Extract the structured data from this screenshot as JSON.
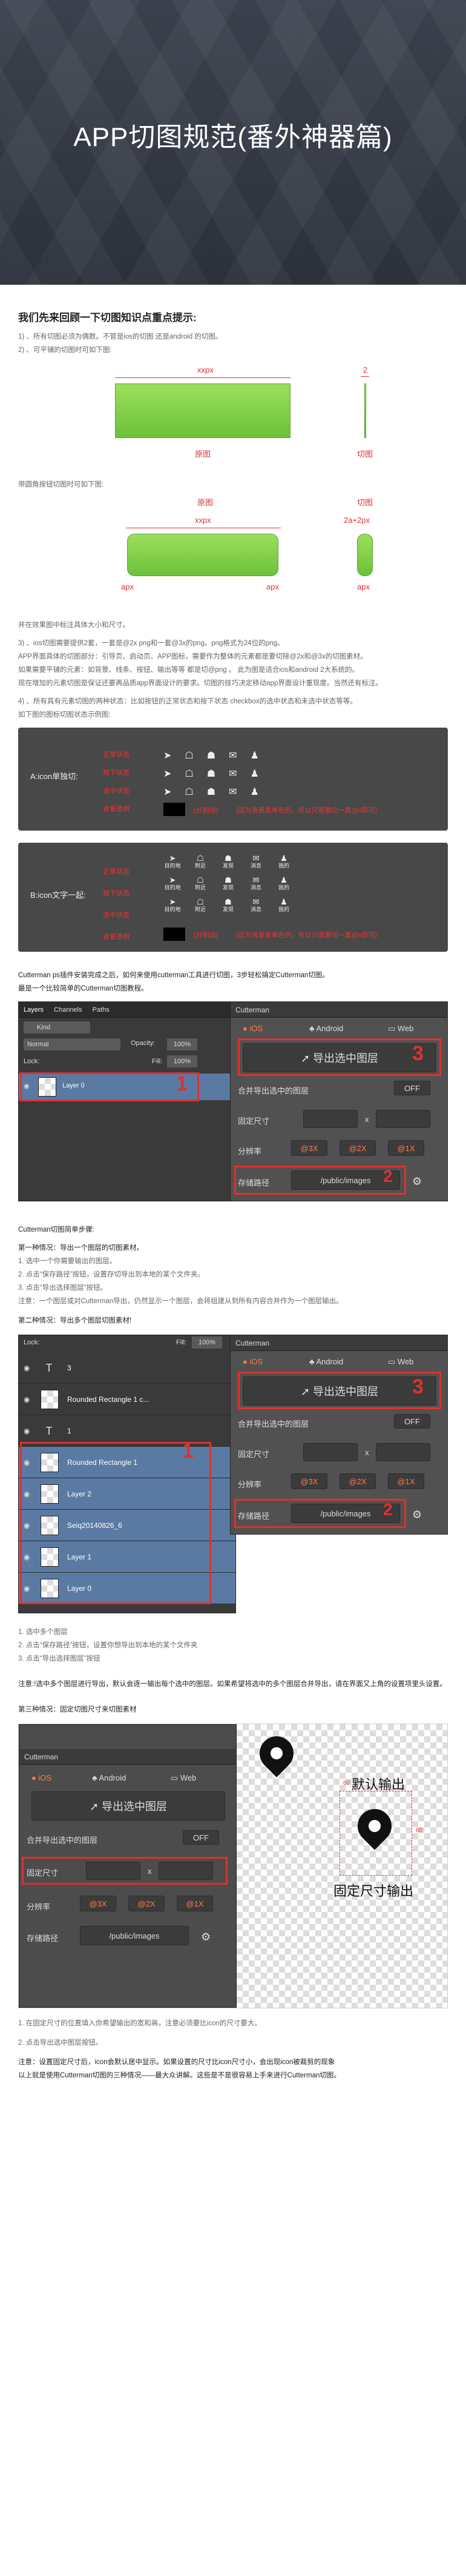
{
  "hero": {
    "title": "APP切图规范(番外神器篇)"
  },
  "intro": {
    "heading": "我们先来回顾一下切图知识点重点提示:",
    "p1": "1) 、所有切图必须为偶数。不管是ios的切图 还是android 的切图。",
    "p2": "2) 、可平铺的切图时可如下图:",
    "label_xxpx": "xxpx",
    "label_2": "2",
    "label_orig": "原图",
    "label_cut": "切图",
    "p3": "带圆角按钮切图时可如下图:",
    "label_orig2": "原图",
    "label_cut2": "切图",
    "label_xxpx2": "xxpx",
    "label_apx_l": "apx",
    "label_apx_r": "apx",
    "label_2a2px": "2a+2px",
    "label_apx_b": "apx",
    "p4": "并在效果图中标注具体大小和尺寸。",
    "p5": "3) 、ios切图需要提供2套，一套是@2x png和一套@3x的png。png格式为24位的png。",
    "p6": "APP界面具体的切图部分：引导页、启动页、APP图标，需要作为整体的元素都是要切除@2x和@3x的切图素材。",
    "p7": "如果需要平铺的元素：如背景、线条、按钮、输出等等 都是切@png 。 此为图是适合ios和android 2大系统的。",
    "p8": "现在增加的元素切图是保证还要再品质app界面设计的要求。切图的技巧决定移动app界面设计重现度。当然还有标注。",
    "p9": "4) 、所有具有元素切图的两种状态：比如按钮的正常状态和按下状态 checkbox的选中状态和未选中状态等等。",
    "p10": "如下图的图标切图状态示例图:"
  },
  "state_panel": {
    "single_label": "A:icon单独切:",
    "mixed_label": "B:icon文字一起:",
    "st_normal": "正常状态",
    "st_pressed": "按下状态",
    "st_selected": "选中状态",
    "st_bg": "背景透明",
    "note_bg": "(分割线)",
    "note_warn": "(因为背景是单色的，所以只需要切一套@x即可)",
    "tab_labels": [
      "目的地",
      "附近",
      "发现",
      "消息",
      "我的"
    ]
  },
  "cutterman_intro": {
    "p1": "Cutterman ps插件安装完成之后，如何来使用cutterman工具进行切图，3步轻松搞定Cutterman切图。",
    "p2": "最是一个比较简单的Cutterman切图教程。"
  },
  "ps1": {
    "tabs": [
      "Layers",
      "Channels",
      "Paths"
    ],
    "kind": "Kind",
    "blend": "Normal",
    "opacity_label": "Opacity:",
    "opacity_value": "100%",
    "lock_label": "Lock:",
    "fill_label": "Fill:",
    "fill_value": "100%",
    "layer_name": "Layer 0",
    "marker": "1"
  },
  "cutterman": {
    "title": "Cutterman",
    "tab_ios": "iOS",
    "tab_android": "Android",
    "tab_web": "Web",
    "export_btn": "导出选中图层",
    "merge_label": "合并导出选中的图层",
    "toggle": "OFF",
    "fixed_size": "固定尺寸",
    "x": "x",
    "resolution": "分辨率",
    "r3": "@3X",
    "r2": "@2X",
    "r1": "@1X",
    "path_label": "存储路径",
    "path_value": "/public/images",
    "marker3": "3",
    "marker2": "2"
  },
  "steps": {
    "heading": "Cutterman切图简单步骤:",
    "case1": "第一种情况：导出一个图层的切图素材。",
    "c1s1": "1. 选中一个你需要输出的图层。",
    "c1s2": "2. 点击“保存路径”按钮，设置存切导出到本地的某个文件夹。",
    "c1s3": "3. 点击“导出选择图层”按钮。",
    "c1note": "注意：一个图层或对Cutterman导出，仍然显示一个图层，会将组建从到所有内容合并作为一个图层输出。",
    "case2": "第二种情况：导出多个图层切图素材!"
  },
  "ps2": {
    "lock_label": "Lock:",
    "fill_label": "Fill:",
    "fill_value": "100%",
    "layers": [
      {
        "name": "3",
        "type": "T"
      },
      {
        "name": "Rounded Rectangle 1 c...",
        "type": "img"
      },
      {
        "name": "1",
        "type": "T"
      },
      {
        "name": "Rounded Rectangle 1",
        "type": "img"
      },
      {
        "name": "Layer 2",
        "type": "img"
      },
      {
        "name": "Seiq20140826_6",
        "type": "img"
      },
      {
        "name": "Layer 1",
        "type": "img"
      },
      {
        "name": "Layer 0",
        "type": "img"
      }
    ],
    "marker": "1"
  },
  "case2_steps": {
    "s1": "1. 选中多个图层",
    "s2": "2. 点击“保存路径”按钮，设置你想导出到本地的某个文件夹",
    "s3": "3. 点击“导出选择图层”按钮",
    "note": "注意:!选中多个图层进行导出，默认会逐一输出每个选中的图层。如果希望将选中的多个图层合并导出，请在界面又上角的设置项里头设置。"
  },
  "case3": {
    "heading": "第三种情况：固定切图尺寸来切图素材",
    "label_default": "默认输出",
    "label_fixed": "固定尺寸输出",
    "dim_w": "60",
    "dim_h": "60",
    "s1": "1. 在固定尺寸的位置填入你希望输出的宽和高，注意必须要比icon的尺寸要大。",
    "s2": "2. 点击导出选中图层按钮。",
    "note1": "注意：设置固定尺寸后，icon会默认居中显示。如果设置的尺寸比icon尺寸小，会出现icon被裁剪的现象",
    "note2": "以上就是使用Cutterman切图的三种情况——最大众讲解。这些是不是很容易上手来进行Cutterman切图。"
  }
}
